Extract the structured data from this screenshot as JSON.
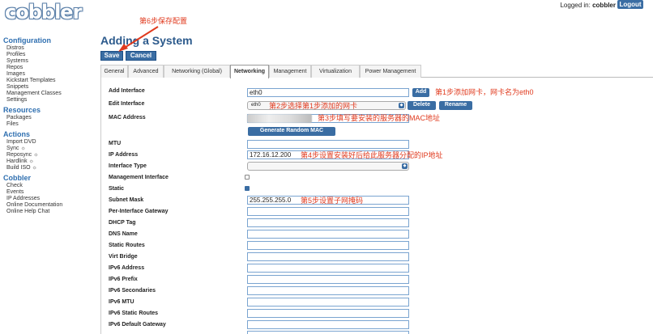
{
  "header": {
    "logo": "cobbler",
    "login_prefix": "Logged in:",
    "login_user": "cobbler",
    "logout": "Logout"
  },
  "sidebar": {
    "sections": [
      {
        "title": "Configuration",
        "items": [
          "Distros",
          "Profiles",
          "Systems",
          "Repos",
          "Images",
          "Kickstart Templates",
          "Snippets",
          "Management Classes",
          "Settings"
        ]
      },
      {
        "title": "Resources",
        "items": [
          "Packages",
          "Files"
        ]
      },
      {
        "title": "Actions",
        "items": [
          "Import DVD",
          "Sync ☼",
          "Reposync ☼",
          "Hardlink ☼",
          "Build ISO ☼"
        ]
      },
      {
        "title": "Cobbler",
        "items": [
          "Check",
          "Events",
          "IP Addresses",
          "Online Documentation",
          "Online Help Chat"
        ]
      }
    ]
  },
  "page": {
    "title": "Adding a System",
    "save": "Save",
    "cancel": "Cancel"
  },
  "tabs": [
    "General",
    "Advanced",
    "Networking (Global)",
    "Networking",
    "Management",
    "Virtualization",
    "Power Management"
  ],
  "form": {
    "add_interface_label": "Add Interface",
    "add_interface_value": "eth0",
    "add_button": "Add",
    "edit_interface_label": "Edit Interface",
    "edit_interface_value": "eth0",
    "delete_button": "Delete",
    "rename_button": "Rename",
    "mac_label": "MAC Address",
    "generate_mac_button": "Generate Random MAC",
    "mtu_label": "MTU",
    "ip_label": "IP Address",
    "ip_value": "172.16.12.200",
    "iftype_label": "Interface Type",
    "mgmt_label": "Management Interface",
    "static_label": "Static",
    "static_checked": true,
    "subnet_label": "Subnet Mask",
    "subnet_value": "255.255.255.0",
    "per_if_gw_label": "Per-Interface Gateway",
    "dhcp_label": "DHCP Tag",
    "dns_label": "DNS Name",
    "static_routes_label": "Static Routes",
    "virt_bridge_label": "Virt Bridge",
    "ipv6_addr_label": "IPv6 Address",
    "ipv6_prefix_label": "IPv6 Prefix",
    "ipv6_secondaries_label": "IPv6 Secondaries",
    "ipv6_mtu_label": "IPv6 MTU",
    "ipv6_static_routes_label": "IPv6 Static Routes",
    "ipv6_default_gw_label": "IPv6 Default Gateway"
  },
  "annotations": {
    "step6": "第6步保存配置",
    "step1": "第1步添加网卡，网卡名为eth0",
    "step2": "第2步选择第1步添加的网卡",
    "step3": "第3步填写要安装的服务器的MAC地址",
    "step4": "第4步设置安装好后给此服务器分配的IP地址",
    "step5": "第5步设置子网掩码",
    "color": "#e03a1e"
  }
}
